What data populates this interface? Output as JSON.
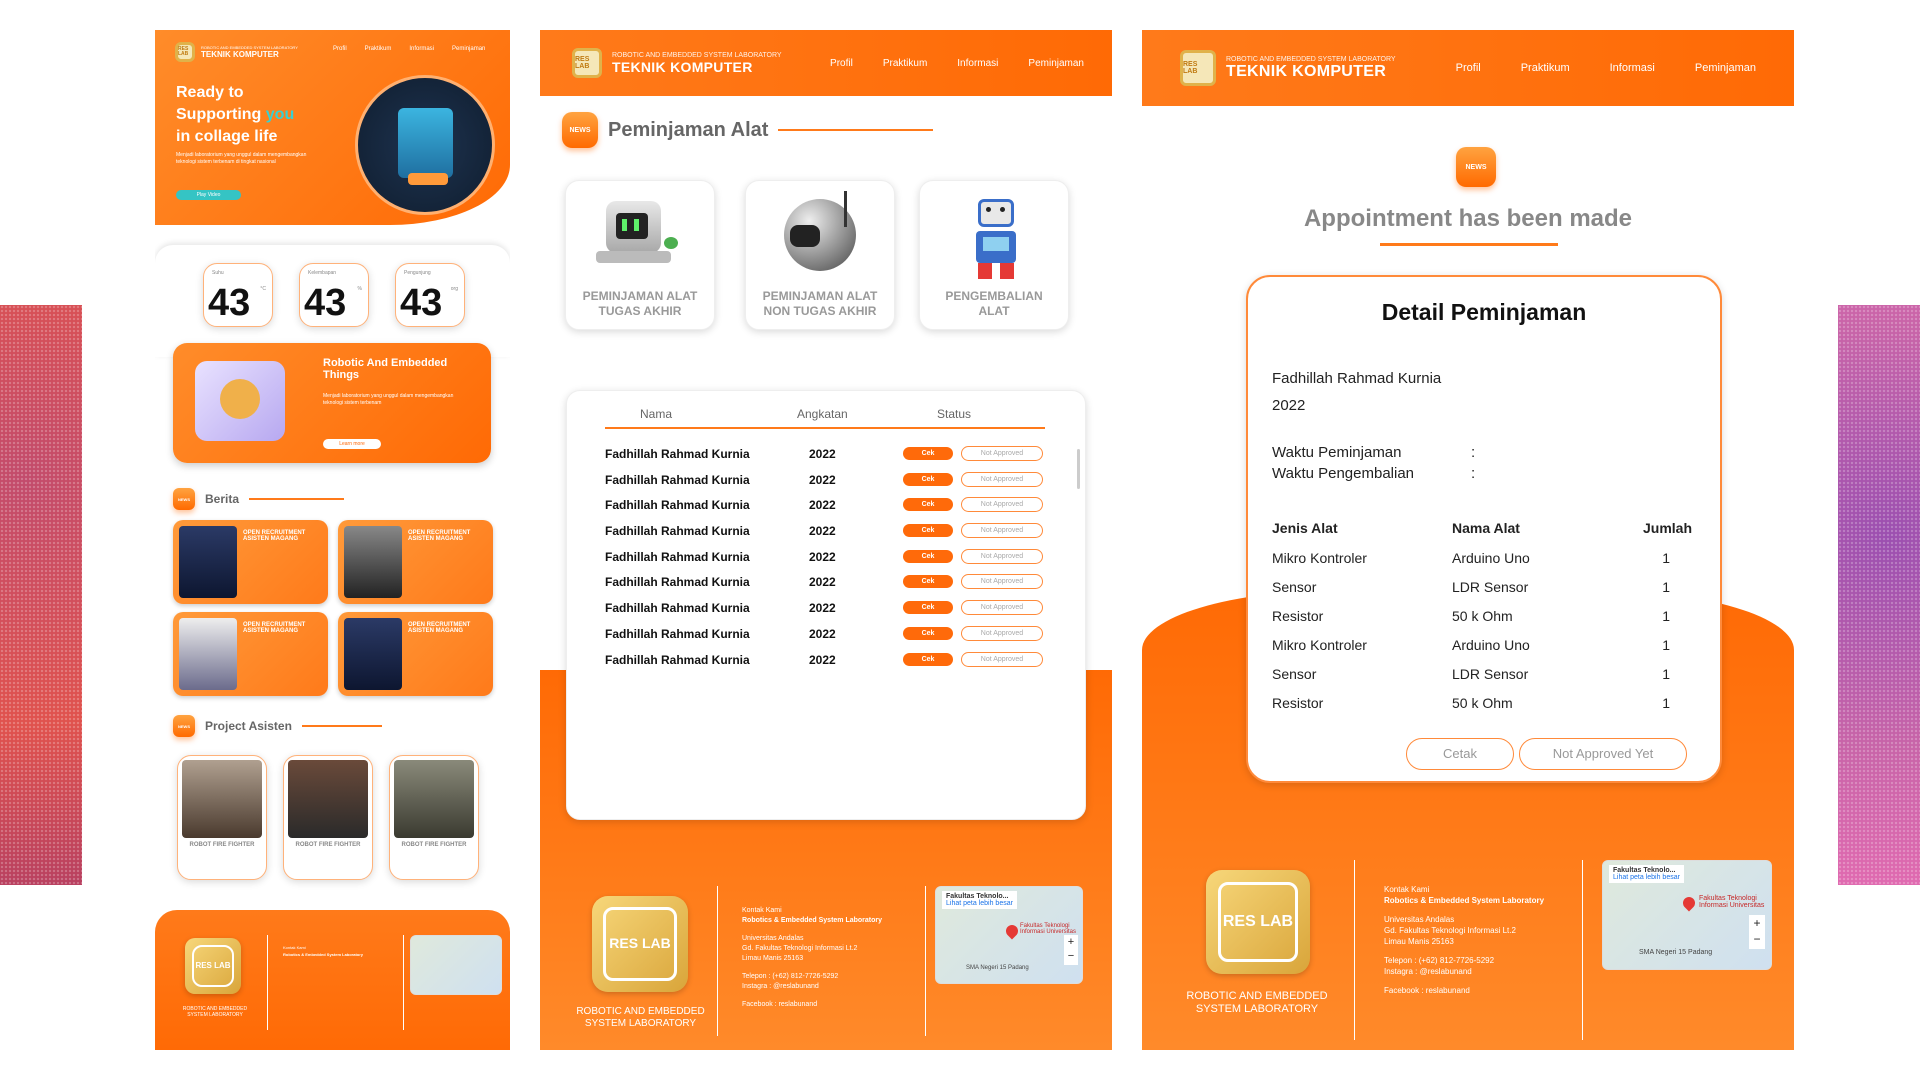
{
  "lab_header": {
    "subtitle": "ROBOTIC AND EMBEDDED SYSTEM LABORATORY",
    "title": "TEKNIK KOMPUTER",
    "logo_text": "RES LAB"
  },
  "nav": [
    "Profil",
    "Praktikum",
    "Informasi",
    "Peminjaman"
  ],
  "home": {
    "hero_line1": "Ready to",
    "hero_line2a": "Supporting ",
    "hero_line2b": "you",
    "hero_line3": "in collage life",
    "hero_desc": "Menjadi laboratorium yang unggul dalam mengembangkan teknologi sistem terbenam di tingkat nasional",
    "play_button": "Play Video",
    "stats": [
      {
        "label": "Suhu",
        "value": "43",
        "unit": "°C"
      },
      {
        "label": "Kelembapan",
        "value": "43",
        "unit": "%"
      },
      {
        "label": "Pengunjung",
        "value": "43",
        "unit": "org"
      }
    ],
    "about_title": "Robotic And Embedded Things",
    "about_desc": "Menjadi laboratorium yang unggul dalam mengembangkan teknologi sistem terbenam",
    "learn_more": "Learn more",
    "news_title": "Berita",
    "news": [
      {
        "title": "OPEN RECRUITMENT ASISTEN MAGANG"
      },
      {
        "title": "OPEN RECRUITMENT ASISTEN MAGANG"
      },
      {
        "title": "OPEN RECRUITMENT ASISTEN MAGANG"
      },
      {
        "title": "OPEN RECRUITMENT ASISTEN MAGANG"
      }
    ],
    "project_title": "Project Asisten",
    "projects": [
      {
        "title": "ROBOT FIRE FIGHTER"
      },
      {
        "title": "ROBOT FIRE FIGHTER"
      },
      {
        "title": "ROBOT FIRE FIGHTER"
      }
    ]
  },
  "pinjam": {
    "page_title": "Peminjaman Alat",
    "badge": "NEWS",
    "options": [
      {
        "line1": "PEMINJAMAN ALAT",
        "line2": "TUGAS AKHIR"
      },
      {
        "line1": "PEMINJAMAN ALAT",
        "line2": "NON TUGAS AKHIR"
      },
      {
        "line1": "PENGEMBALIAN",
        "line2": "ALAT"
      }
    ],
    "table_headers": {
      "nama": "Nama",
      "angkatan": "Angkatan",
      "status": "Status"
    },
    "rows": [
      {
        "nama": "Fadhillah Rahmad Kurnia",
        "angkatan": "2022",
        "cek": "Cek",
        "status": "Not Approved"
      },
      {
        "nama": "Fadhillah Rahmad Kurnia",
        "angkatan": "2022",
        "cek": "Cek",
        "status": "Not Approved"
      },
      {
        "nama": "Fadhillah Rahmad Kurnia",
        "angkatan": "2022",
        "cek": "Cek",
        "status": "Not Approved"
      },
      {
        "nama": "Fadhillah Rahmad Kurnia",
        "angkatan": "2022",
        "cek": "Cek",
        "status": "Not Approved"
      },
      {
        "nama": "Fadhillah Rahmad Kurnia",
        "angkatan": "2022",
        "cek": "Cek",
        "status": "Not Approved"
      },
      {
        "nama": "Fadhillah Rahmad Kurnia",
        "angkatan": "2022",
        "cek": "Cek",
        "status": "Not Approved"
      },
      {
        "nama": "Fadhillah Rahmad Kurnia",
        "angkatan": "2022",
        "cek": "Cek",
        "status": "Not Approved"
      },
      {
        "nama": "Fadhillah Rahmad Kurnia",
        "angkatan": "2022",
        "cek": "Cek",
        "status": "Not Approved"
      },
      {
        "nama": "Fadhillah Rahmad Kurnia",
        "angkatan": "2022",
        "cek": "Cek",
        "status": "Not Approved"
      }
    ]
  },
  "detail": {
    "heading": "Appointment has been made",
    "card_title": "Detail Peminjaman",
    "name": "Fadhillah Rahmad Kurnia",
    "year": "2022",
    "waktu_pinjam": "Waktu Peminjaman",
    "waktu_kembali": "Waktu Pengembalian",
    "colon": ":",
    "headers": {
      "jenis": "Jenis  Alat",
      "nama": "Nama Alat",
      "jumlah": "Jumlah"
    },
    "items": [
      {
        "jenis": "Mikro Kontroler",
        "nama": "Arduino Uno",
        "jumlah": "1"
      },
      {
        "jenis": "Sensor",
        "nama": "LDR Sensor",
        "jumlah": "1"
      },
      {
        "jenis": "Resistor",
        "nama": "50 k Ohm",
        "jumlah": "1"
      },
      {
        "jenis": "Mikro Kontroler",
        "nama": "Arduino Uno",
        "jumlah": "1"
      },
      {
        "jenis": "Sensor",
        "nama": "LDR Sensor",
        "jumlah": "1"
      },
      {
        "jenis": "Resistor",
        "nama": "50 k Ohm",
        "jumlah": "1"
      }
    ],
    "cetak": "Cetak",
    "status": "Not Approved Yet"
  },
  "footer": {
    "logo": "RES LAB",
    "lab_name": "ROBOTIC AND EMBEDDED SYSTEM LABORATORY",
    "kontak": "Kontak Kami",
    "lab_full": "Robotics & Embedded System Laboratory",
    "addr1": "Universitas Andalas",
    "addr2": "Gd. Fakultas Teknologi Informasi Lt.2",
    "addr3": "Limau Manis 25163",
    "telp": "Telepon : (+62) 812-7726-5292",
    "ig": "Instagra : @reslabunand",
    "fb": "Facebook : reslabunand",
    "map_label": "Fakultas Teknolo...",
    "map_link": "Lihat peta lebih besar",
    "map_pin": "Fakultas Teknologi Informasi Universitas",
    "map_school": "SMA Negeri 15 Padang"
  },
  "colors": {
    "accent": "#ff6b0a"
  }
}
